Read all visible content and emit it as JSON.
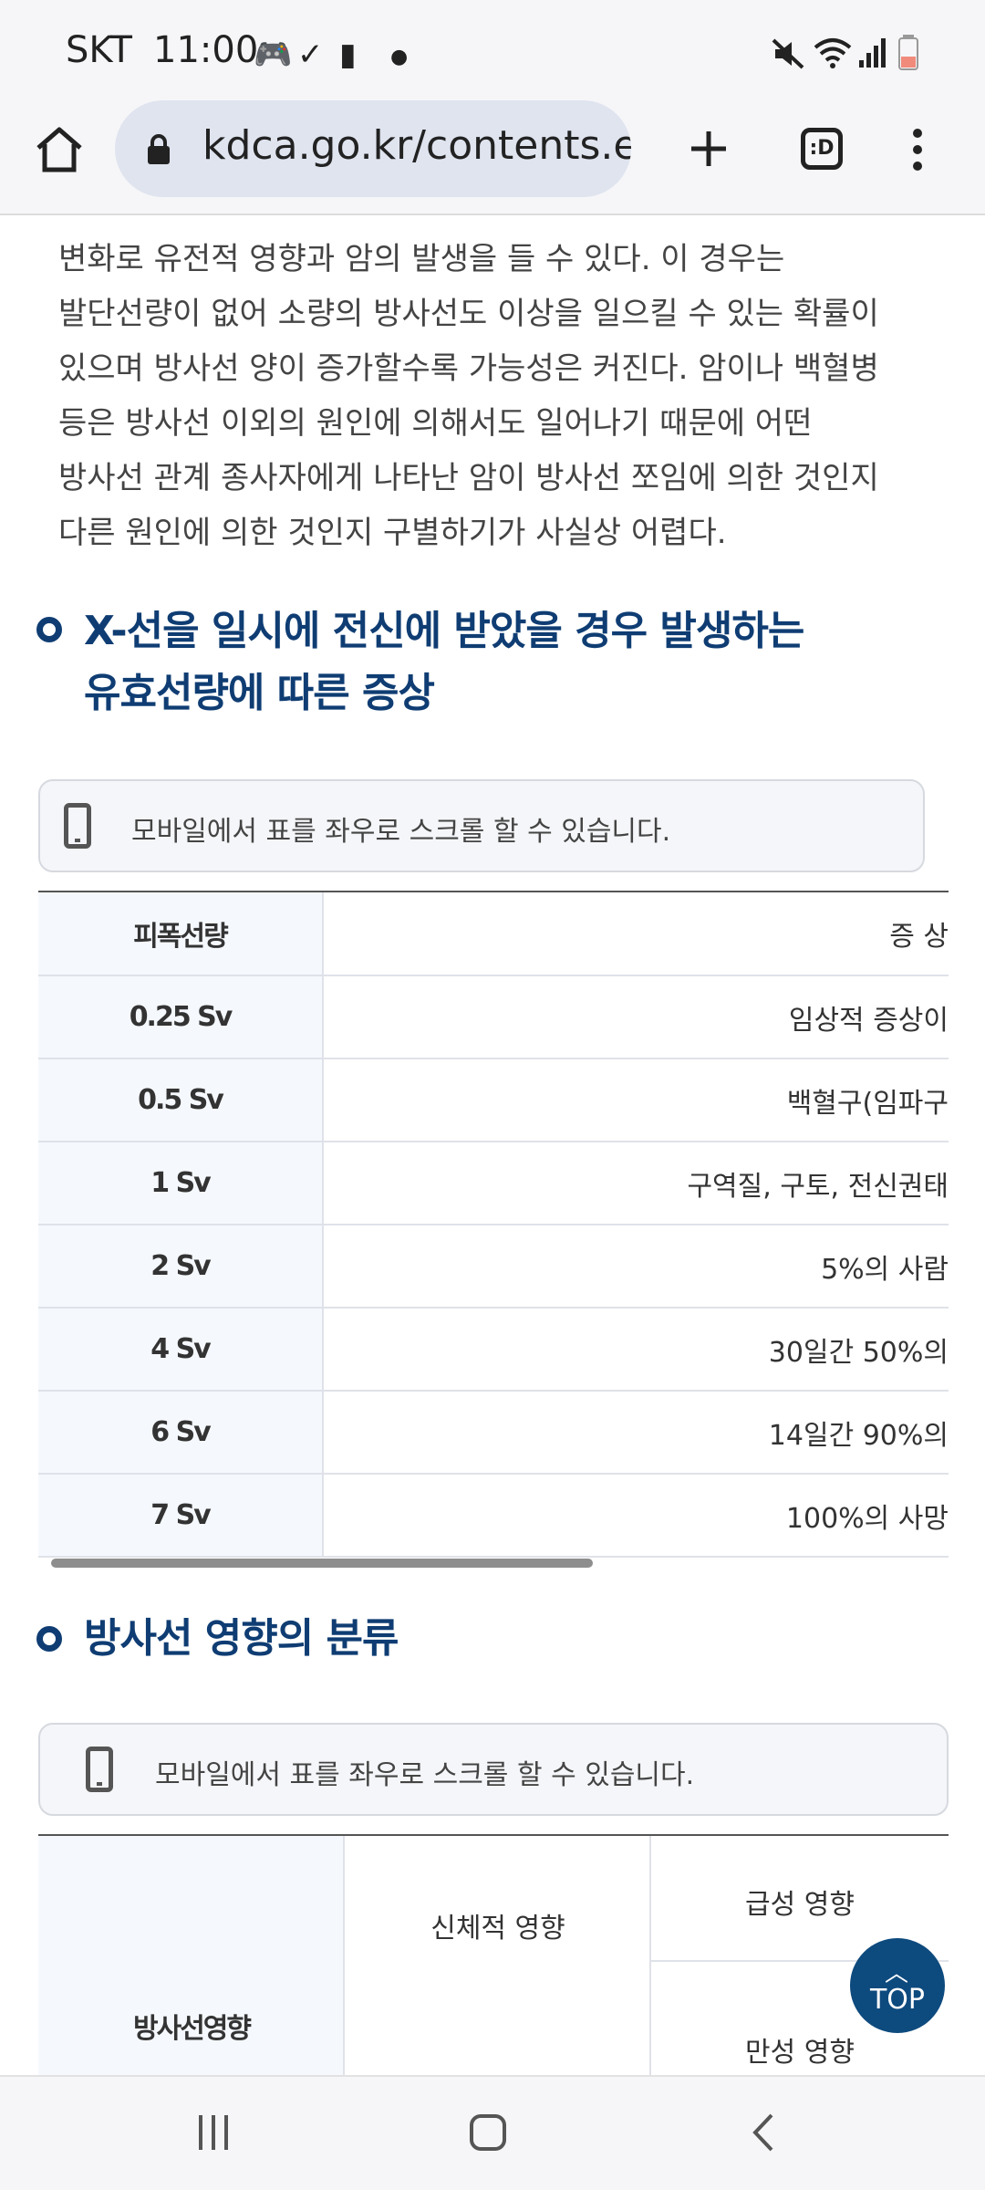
{
  "status_bar": {
    "carrier": "SKT",
    "time": "11:00",
    "icons": [
      "game-controller-icon",
      "check-download-icon",
      "battery-alert-icon",
      "dot-icon",
      "mute-icon",
      "wifi-icon",
      "signal-icon",
      "battery-icon"
    ]
  },
  "browser": {
    "url": "kdca.go.kr/contents.es",
    "tab_count_label": ":D"
  },
  "content": {
    "intro_lines": [
      "변화로 유전적 영향과 암의 발생을 들 수 있다. 이 경우는",
      "발단선량이 없어 소량의 방사선도 이상을 일으킬 수 있는 확률이",
      "있으며 방사선 양이 증가할수록 가능성은 커진다. 암이나 백혈병",
      "등은 방사선 이외의 원인에 의해서도 일어나기 때문에 어떤",
      "방사선 관계 종사자에게 나타난 암이 방사선 쪼임에 의한 것인지",
      "다른 원인에 의한 것인지 구별하기가 사실상 어렵다."
    ],
    "section1_title_line1": "X-선을 일시에 전신에 받았을 경우 발생하는",
    "section1_title_line2": "유효선량에 따른 증상",
    "scroll_notice": "모바일에서 표를 좌우로 스크롤 할 수 있습니다.",
    "table1": {
      "headers": [
        "피폭선량",
        "증 상"
      ],
      "rows": [
        [
          "0.25 Sv",
          "임상적 증상이"
        ],
        [
          "0.5 Sv",
          "백혈구(임파구"
        ],
        [
          "1 Sv",
          "구역질, 구토, 전신권태"
        ],
        [
          "2 Sv",
          "5%의 사람"
        ],
        [
          "4 Sv",
          "30일간 50%의"
        ],
        [
          "6 Sv",
          "14일간 90%의"
        ],
        [
          "7 Sv",
          "100%의 사망"
        ]
      ]
    },
    "section2_title": "방사선 영향의 분류",
    "scroll_notice2": "모바일에서 표를 좌우로 스크롤 할 수 있습니다.",
    "table2": {
      "row_header": "방사선영향",
      "col2": "신체적 영향",
      "col3_top": "급성 영향",
      "col3_bottom": "만성 영향"
    },
    "top_button": "TOP"
  },
  "colors": {
    "heading": "#0f3d73",
    "top_button": "#0d4a7e",
    "url_pill": "#dfe4ef"
  }
}
